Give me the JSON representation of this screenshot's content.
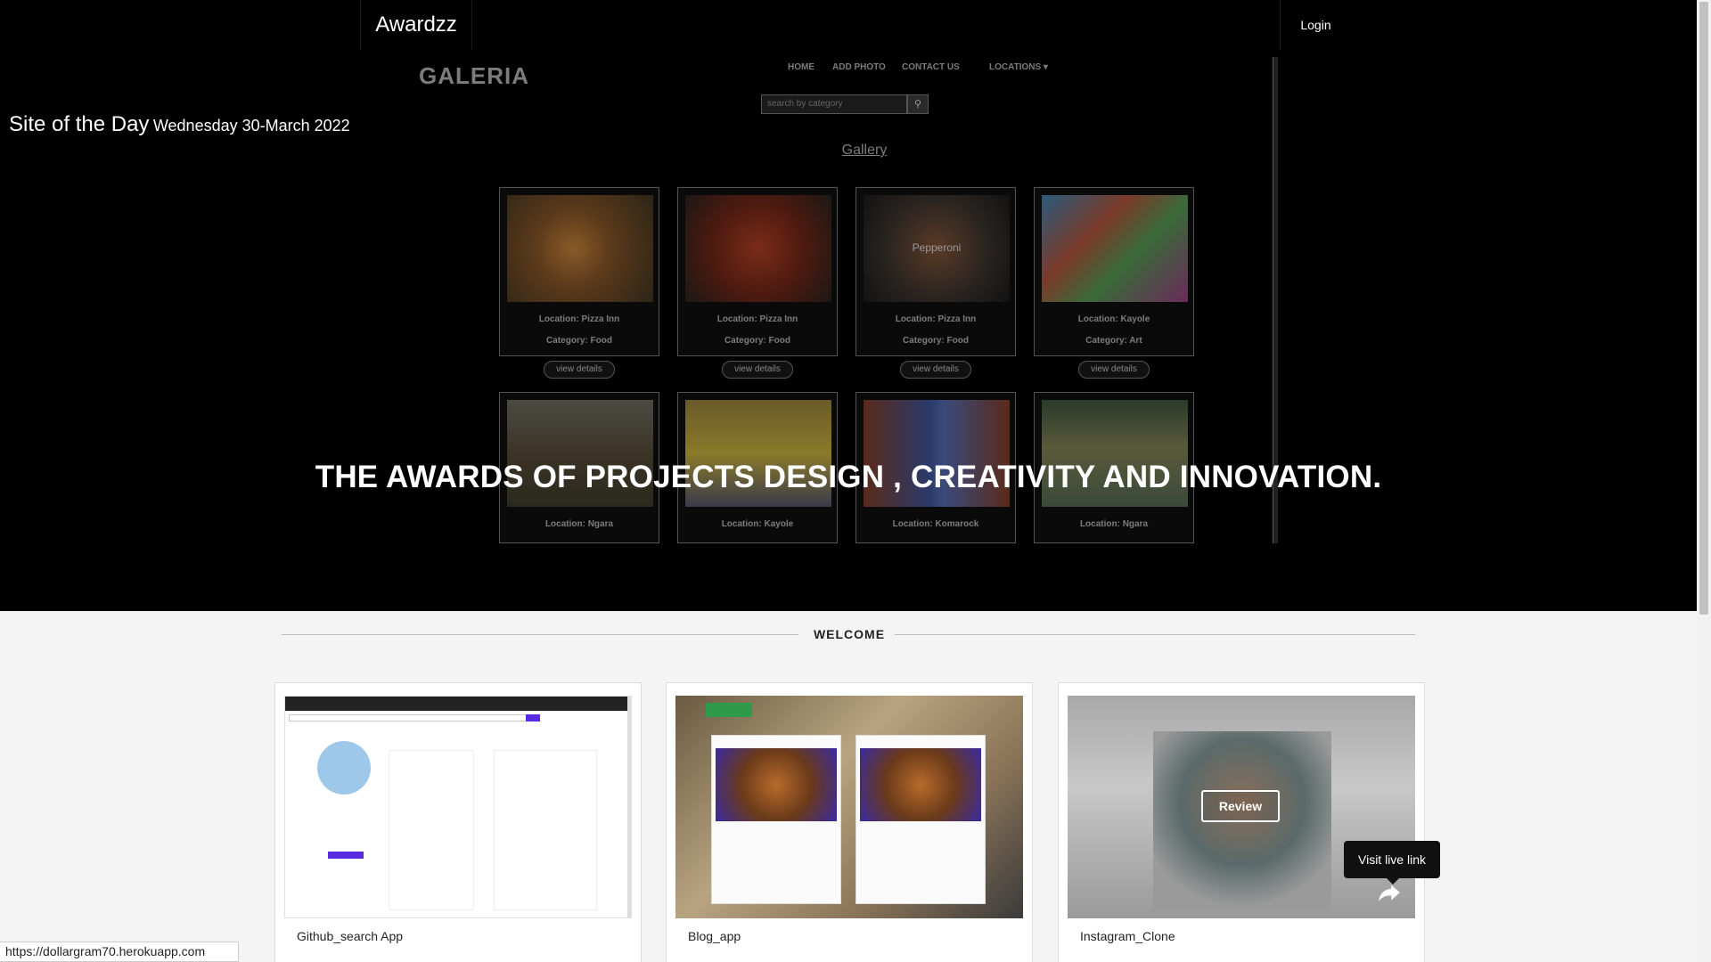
{
  "navbar": {
    "brand": "Awardzz",
    "login": "Login"
  },
  "hero": {
    "site_of_day": "Site of the Day",
    "date": "Wednesday 30-March 2022",
    "title": "THE AWARDS OF PROJECTS DESIGN , CREATIVITY AND INNOVATION."
  },
  "preview": {
    "logo": "GALERIA",
    "nav": [
      "HOME",
      "ADD PHOTO",
      "CONTACT US",
      "LOCATIONS ▾"
    ],
    "search_placeholder": "search by category",
    "heading": "Gallery",
    "cards": [
      {
        "location": "Location: Pizza Inn",
        "category": "Category: Food",
        "button": "view details"
      },
      {
        "location": "Location: Pizza Inn",
        "category": "Category: Food",
        "button": "view details"
      },
      {
        "location": "Location: Pizza Inn",
        "category": "Category: Food",
        "button": "view details",
        "overlay": "Pepperoni"
      },
      {
        "location": "Location: Kayole",
        "category": "Category: Art",
        "button": "view details"
      },
      {
        "location": "Location: Ngara"
      },
      {
        "location": "Location: Kayole"
      },
      {
        "location": "Location: Komarock"
      },
      {
        "location": "Location: Ngara"
      }
    ]
  },
  "welcome": {
    "label": "WELCOME"
  },
  "projects": [
    {
      "title": "Github_search App"
    },
    {
      "title": "Blog_app"
    },
    {
      "title": "Instagram_Clone",
      "review": "Review"
    }
  ],
  "tooltip": "Visit live link",
  "status_url": "https://dollargram70.herokuapp.com"
}
